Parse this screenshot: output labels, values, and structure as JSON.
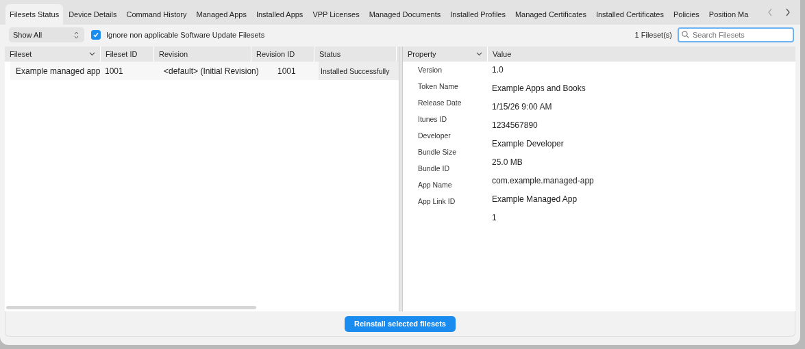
{
  "tabs": [
    {
      "label": "Filesets Status",
      "selected": true
    },
    {
      "label": "Device Details",
      "selected": false
    },
    {
      "label": "Command History",
      "selected": false
    },
    {
      "label": "Managed Apps",
      "selected": false
    },
    {
      "label": "Installed Apps",
      "selected": false
    },
    {
      "label": "VPP Licenses",
      "selected": false
    },
    {
      "label": "Managed Documents",
      "selected": false
    },
    {
      "label": "Installed Profiles",
      "selected": false
    },
    {
      "label": "Managed Certificates",
      "selected": false
    },
    {
      "label": "Installed Certificates",
      "selected": false
    },
    {
      "label": "Policies",
      "selected": false
    },
    {
      "label": "Position Ma",
      "selected": false
    }
  ],
  "toolbar": {
    "filter": {
      "value": "Show All"
    },
    "ignore_checkbox": {
      "label": "Ignore non applicable Software Update Filesets",
      "checked": true
    },
    "count": "1 Fileset(s)",
    "search": {
      "placeholder": "Search Filesets"
    }
  },
  "filesets_table": {
    "columns": [
      "Fileset",
      "Fileset ID",
      "Revision",
      "Revision ID",
      "Status"
    ],
    "rows": [
      {
        "cells": [
          "Example managed app",
          "1001",
          "<default> (Initial Revision)",
          "1001",
          "Installed Successfully"
        ]
      }
    ]
  },
  "properties_table": {
    "columns": [
      "Property",
      "Value"
    ],
    "properties": [
      "Version",
      "Token Name",
      "Release Date",
      "Itunes ID",
      "Developer",
      "Bundle Size",
      "Bundle ID",
      "App Name",
      "App Link ID"
    ],
    "values": [
      "1.0",
      "Example Apps and Books",
      "1/15/26 9:00 AM",
      "1234567890",
      "Example Developer",
      "25.0 MB",
      "com.example.managed-app",
      "Example Managed App",
      "1"
    ]
  },
  "buttons": [
    "Reinstall selected filesets"
  ]
}
